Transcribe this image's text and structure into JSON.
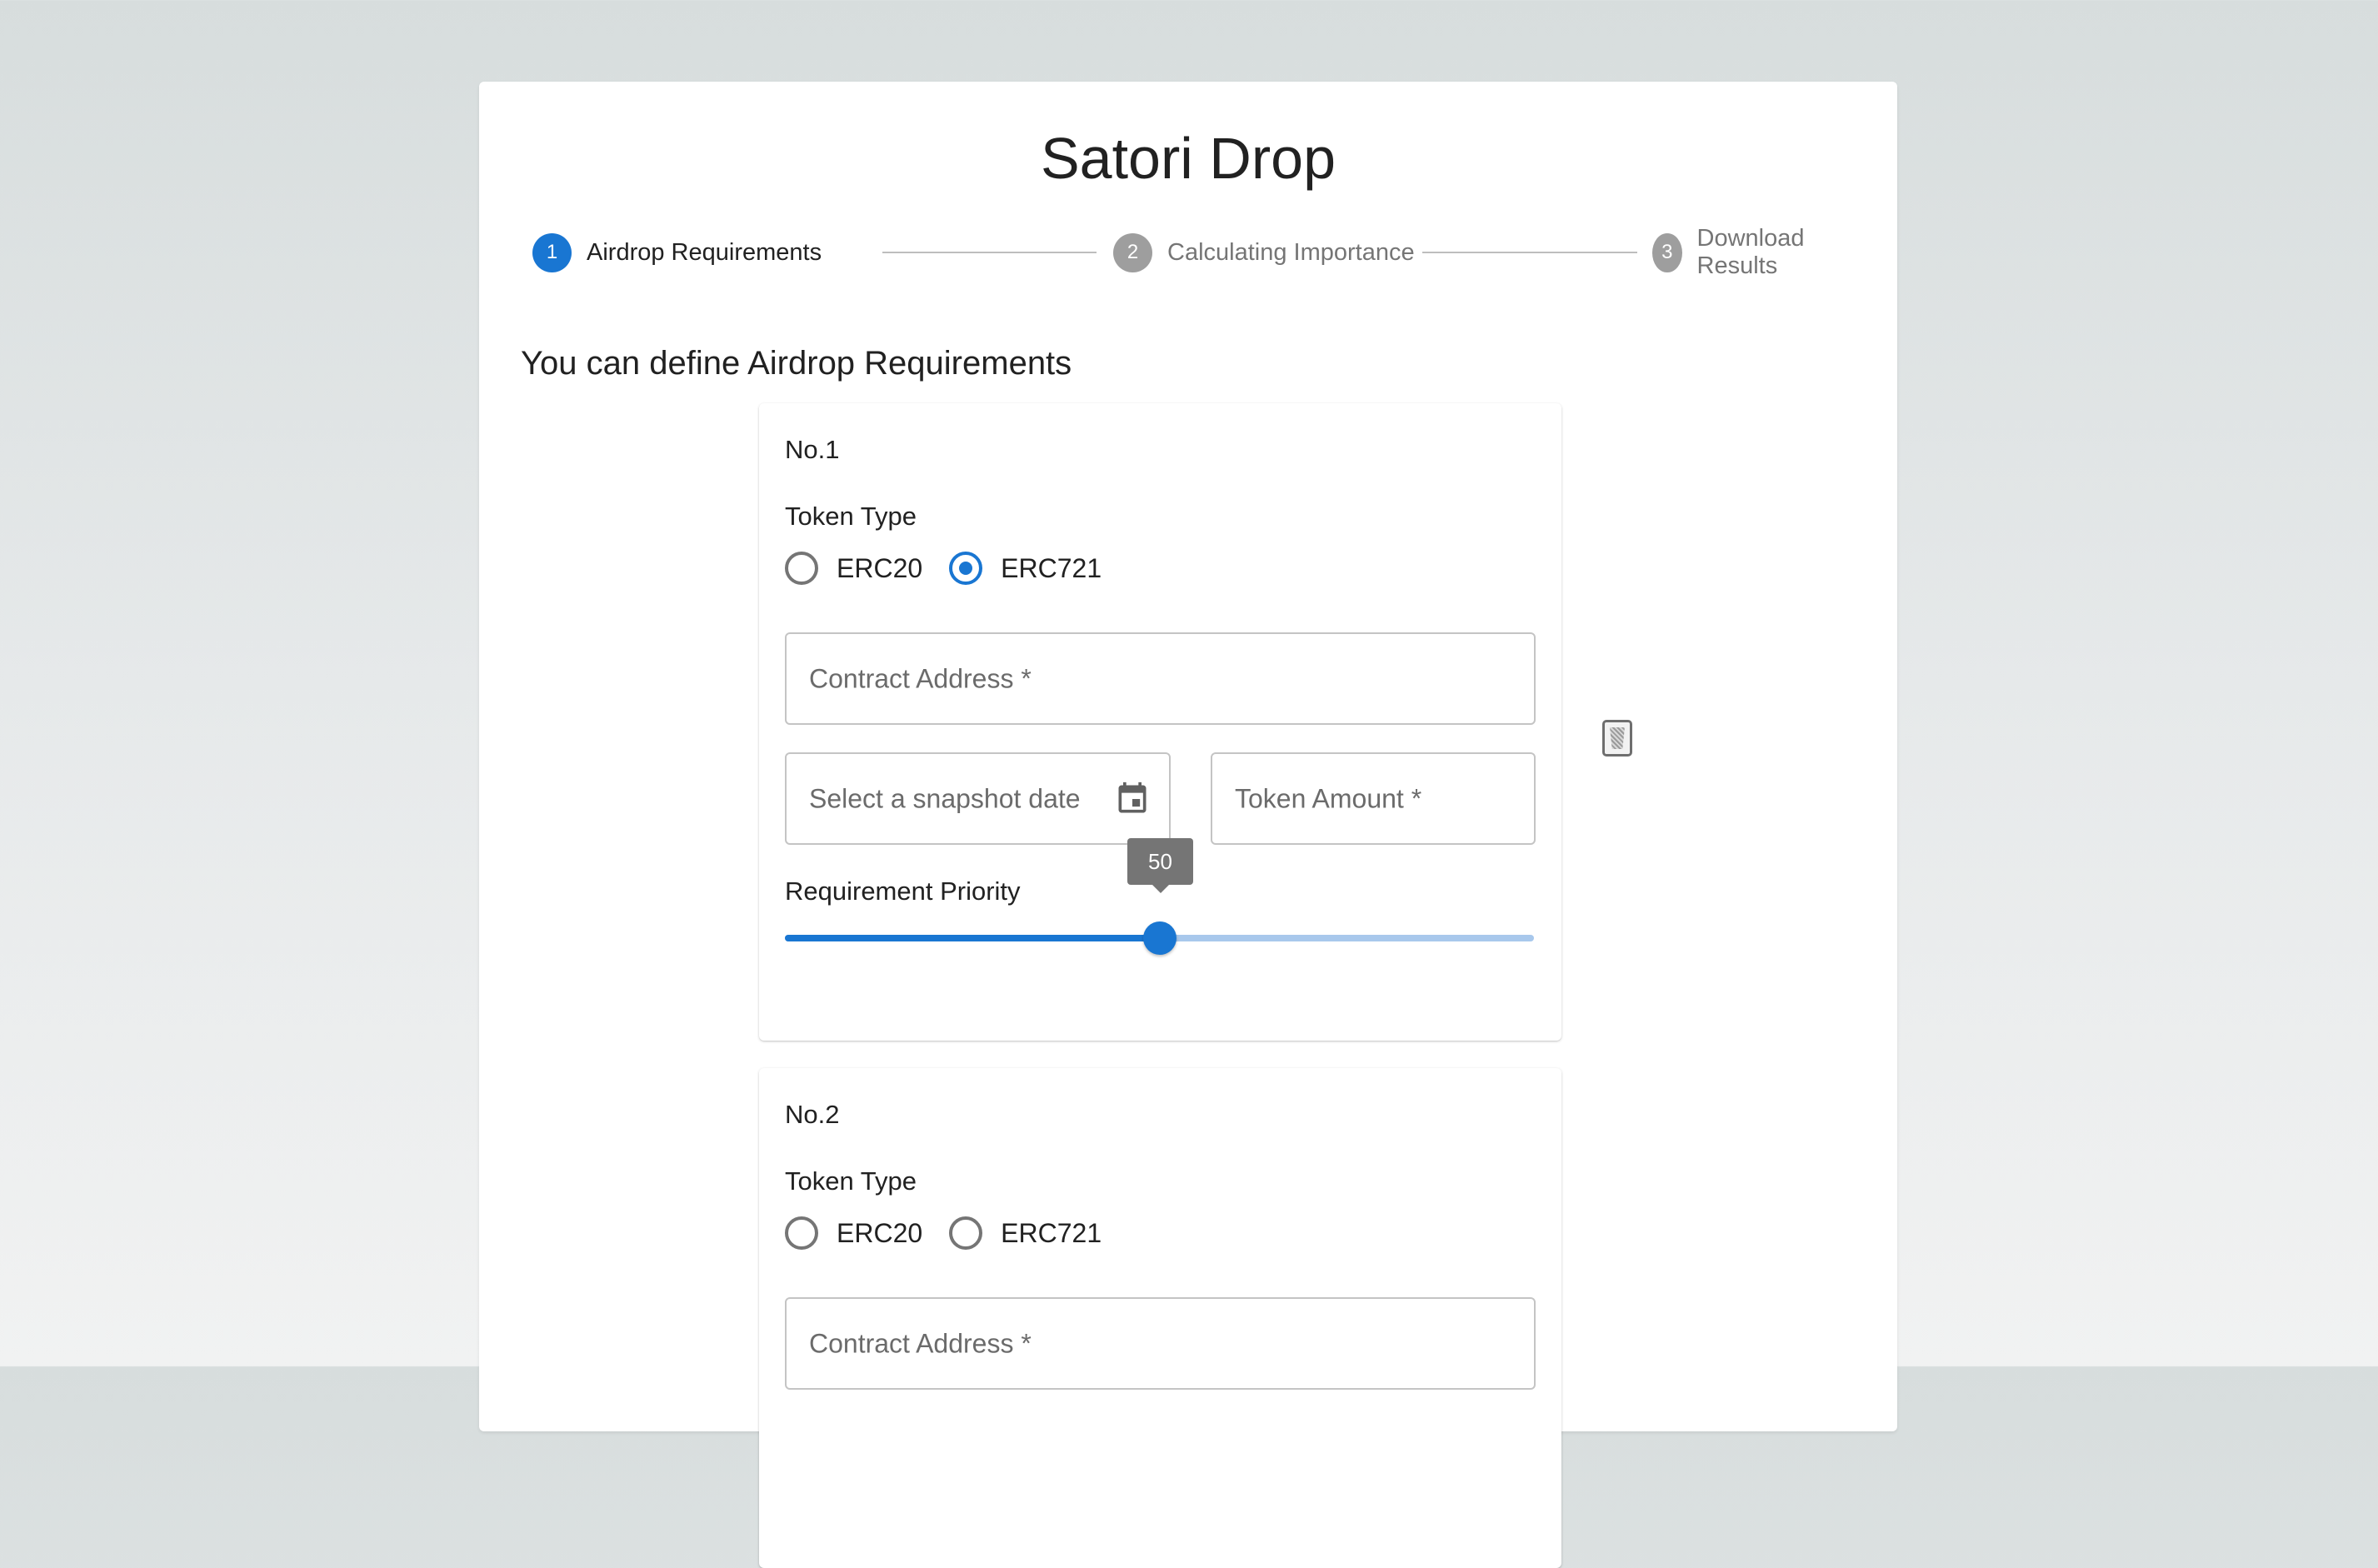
{
  "app": {
    "title": "Satori Drop"
  },
  "stepper": {
    "steps": [
      {
        "number": "1",
        "label": "Airdrop Requirements",
        "state": "active"
      },
      {
        "number": "2",
        "label": "Calculating Importance",
        "state": "inactive"
      },
      {
        "number": "3",
        "label": "Download Results",
        "state": "inactive"
      }
    ]
  },
  "main": {
    "subheading": "You can define Airdrop Requirements"
  },
  "requirements": [
    {
      "number_label": "No.1",
      "token_type_label": "Token Type",
      "token_types": [
        {
          "label": "ERC20",
          "checked": false
        },
        {
          "label": "ERC721",
          "checked": true
        }
      ],
      "contract_address_placeholder": "Contract Address *",
      "snapshot_date_placeholder": "Select a snapshot date",
      "token_amount_placeholder": "Token Amount *",
      "priority_label": "Requirement Priority",
      "priority_value": "50",
      "priority_fraction": 0.5
    },
    {
      "number_label": "No.2",
      "token_type_label": "Token Type",
      "token_types": [
        {
          "label": "ERC20",
          "checked": false
        },
        {
          "label": "ERC721",
          "checked": false
        }
      ],
      "contract_address_placeholder": "Contract Address *"
    }
  ],
  "icons": {
    "delete": "trash-icon",
    "calendar": "calendar-icon"
  },
  "colors": {
    "primary": "#1976d2",
    "inactive_step": "#9e9e9e",
    "slider_rail": "#a8c8ec",
    "tooltip": "#757575"
  }
}
